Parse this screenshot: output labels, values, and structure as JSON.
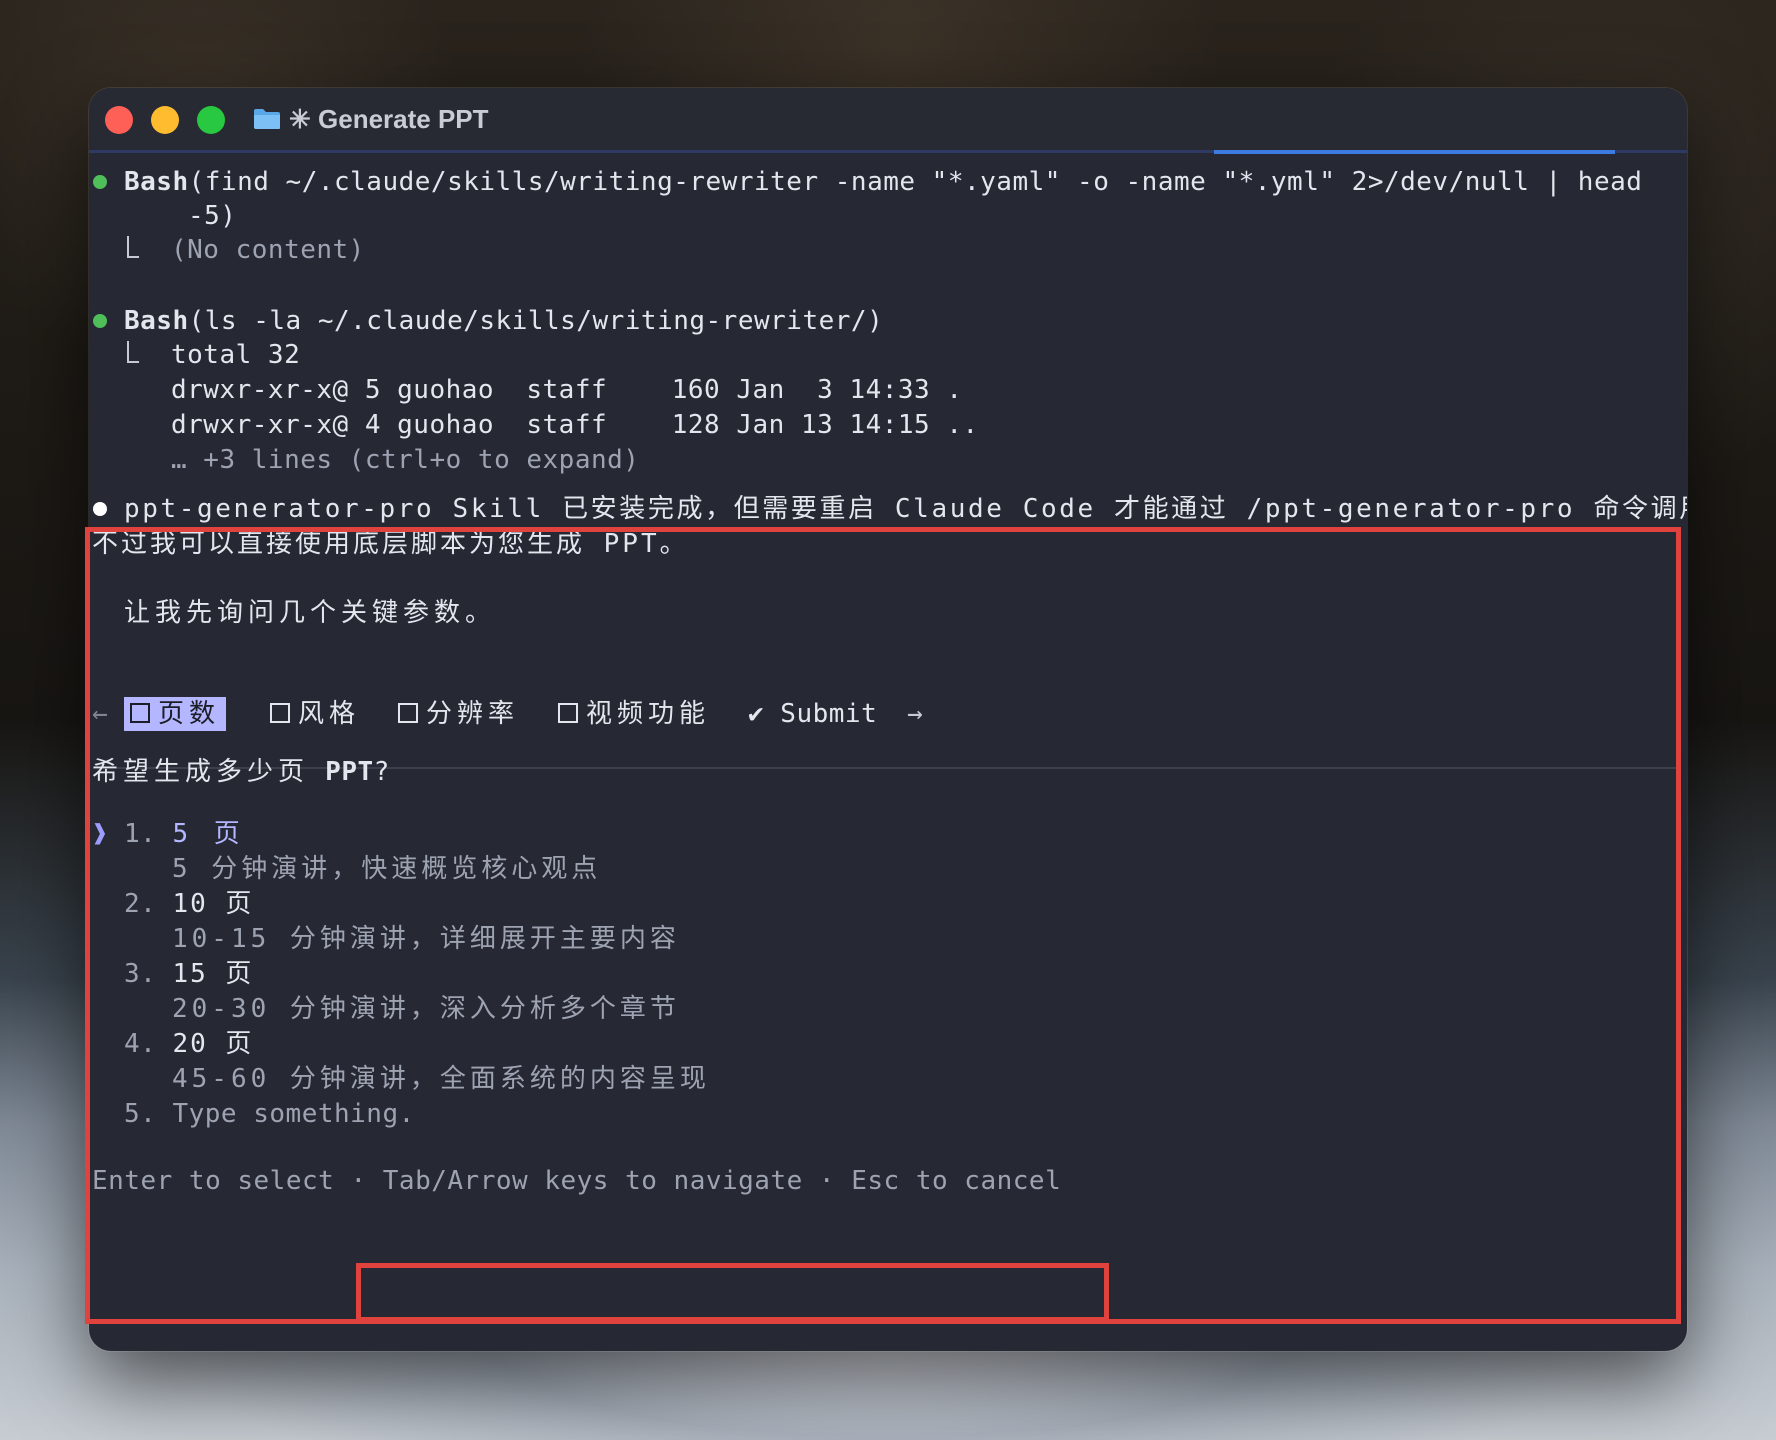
{
  "window": {
    "title": "✳ Generate PPT"
  },
  "blocks": {
    "bash1": {
      "tool": "Bash",
      "command_line1": "(find ~/.claude/skills/writing-rewriter -name \"*.yaml\" -o -name \"*.yml\" 2>/dev/null | head",
      "command_line2": "-5)",
      "result": "(No content)"
    },
    "bash2": {
      "tool": "Bash",
      "command": "(ls -la ~/.claude/skills/writing-rewriter/)",
      "output": [
        "total 32",
        "drwxr-xr-x@ 5 guohao  staff    160 Jan  3 14:33 .",
        "drwxr-xr-x@ 4 guohao  staff    128 Jan 13 14:15 .."
      ],
      "more": "… +3 lines (ctrl+o to expand)"
    },
    "message": {
      "line1": "ppt-generator-pro Skill 已安装完成，但需要重启 Claude Code 才能通过 /ppt-generator-pro 命令调用。",
      "line2": "不过我可以直接使用底层脚本为您生成 PPT。",
      "line3": "让我先询问几个关键参数。"
    }
  },
  "question_tabs": {
    "back_arrow": "←",
    "forward_arrow": "→",
    "tabs": [
      {
        "label": "页数",
        "state": "active"
      },
      {
        "label": "风格",
        "state": "unchecked"
      },
      {
        "label": "分辨率",
        "state": "unchecked"
      },
      {
        "label": "视频功能",
        "state": "unchecked"
      }
    ],
    "submit": "✔ Submit"
  },
  "question": {
    "prompt_cjk": "希望生成多少页",
    "prompt_bold": "PPT",
    "prompt_end": "?",
    "marker": "❱",
    "options": [
      {
        "num": "1.",
        "label": "5 页",
        "desc": "5 分钟演讲，快速概览核心观点",
        "selected": true
      },
      {
        "num": "2.",
        "label": "10 页",
        "desc": "10-15 分钟演讲，详细展开主要内容"
      },
      {
        "num": "3.",
        "label": "15 页",
        "desc": "20-30 分钟演讲，深入分析多个章节"
      },
      {
        "num": "4.",
        "label": "20 页",
        "desc": "45-60 分钟演讲，全面系统的内容呈现"
      },
      {
        "num": "5.",
        "label": "Type something."
      }
    ]
  },
  "footer": {
    "enter": "Enter to select",
    "sep": "·",
    "nav": "Tab/Arrow keys to navigate · Esc to cancel"
  },
  "colors": {
    "terminal_bg": "#262833",
    "accent_lavender": "#b4b6ff",
    "bash_dot": "#4fbf5a",
    "annotation_red": "#e0423e"
  }
}
